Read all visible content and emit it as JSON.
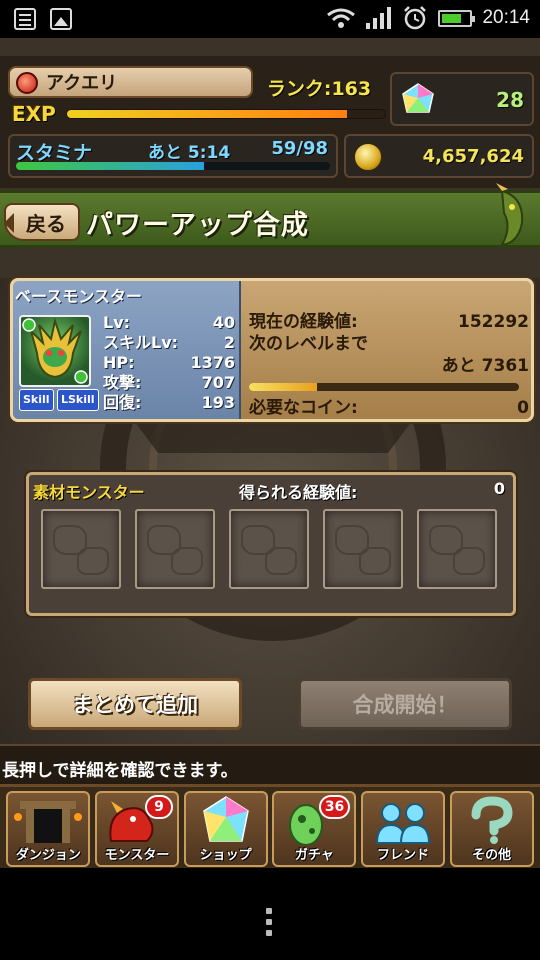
{
  "status_bar": {
    "time": "20:14",
    "icons": [
      "notes-icon",
      "gallery-icon",
      "wifi-icon",
      "signal-icon",
      "alarm-icon",
      "battery-icon"
    ],
    "battery_level": 0.7
  },
  "player": {
    "name": "アクエリ",
    "rank": "ランク:163",
    "exp_label": "EXP",
    "exp_progress": 0.88,
    "magic_stones": "28",
    "stamina_label": "スタミナ",
    "stamina_timer": "あと 5:14",
    "stamina_value": "59/98",
    "stamina_progress": 0.6,
    "coins": "4,657,624"
  },
  "banner": {
    "back_label": "戻る",
    "title": "パワーアップ合成"
  },
  "base_monster": {
    "title": "ベースモンスター",
    "badges": [
      "Skill",
      "LSkill"
    ],
    "stats": [
      {
        "label": "Lv:",
        "value": "40"
      },
      {
        "label": "スキルLv:",
        "value": "2"
      },
      {
        "label": "HP:",
        "value": "1376"
      },
      {
        "label": "攻撃:",
        "value": "707"
      },
      {
        "label": "回復:",
        "value": "193"
      }
    ],
    "current_exp_label": "現在の経験値:",
    "current_exp": "152292",
    "next_level_label": "次のレベルまで",
    "next_level_remaining": "あと 7361",
    "next_level_progress": 0.25,
    "coin_needed_label": "必要なコイン:",
    "coin_needed": "0"
  },
  "materials": {
    "title": "素材モンスター",
    "exp_gain_label": "得られる経験値:",
    "exp_gain": "0",
    "slot_count": 5
  },
  "buttons": {
    "add_together": "まとめて追加",
    "start_fusion": "合成開始！"
  },
  "hint": "長押しで詳細を確認できます。",
  "tabs": [
    {
      "label": "ダンジョン",
      "icon": "dungeon-gate-icon",
      "badge": ""
    },
    {
      "label": "モンスター",
      "icon": "red-dragon-icon",
      "badge": "9"
    },
    {
      "label": "ショップ",
      "icon": "magic-stone-icon",
      "badge": ""
    },
    {
      "label": "ガチャ",
      "icon": "egg-icon",
      "badge": "36"
    },
    {
      "label": "フレンド",
      "icon": "friends-icon",
      "badge": ""
    },
    {
      "label": "その他",
      "icon": "question-icon",
      "badge": ""
    }
  ]
}
